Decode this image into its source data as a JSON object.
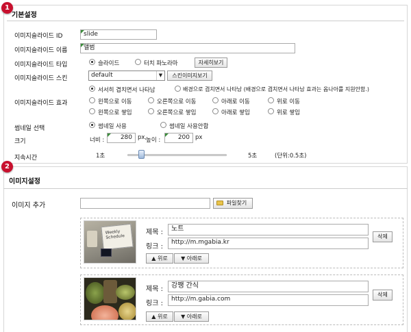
{
  "basic": {
    "badge": "1",
    "title": "기본설정",
    "fields": {
      "id_label": "이미지슬라이드 ID",
      "id_value": "slide",
      "name_label": "이미지슬라이드 이름",
      "name_value": "앨범",
      "type_label": "이미지슬라이드 타입",
      "type_options": [
        "슬라이드",
        "터치 파노라마"
      ],
      "type_detail_button": "자세히보기",
      "skin_label": "이미지슬라이드 스킨",
      "skin_value": "default",
      "skin_preview_button": "스킨이미지보기",
      "effect_label": "이미지슬라이드 효과",
      "effect_options": [
        "서서히 겹치면서 나타남",
        "배경으로 겹치면서 나타남 (배경으로 겹치면서 나타남 효과는 옵나아를 지원안함.)",
        "왼쪽으로 이동",
        "오른쪽으로 이동",
        "아래로 이동",
        "위로 이동",
        "왼쪽으로 쌓임",
        "오른쪽으로 쌓임",
        "아래로 쌓임",
        "위로 쌓임"
      ],
      "thumb_label": "썸네일 선택",
      "thumb_options": [
        "썸네일 사용",
        "썸네일 사용안함"
      ],
      "size_label": "크기",
      "width_label": "너비 :",
      "width_value": "280",
      "width_unit": "px,",
      "height_label": "높이 :",
      "height_value": "200",
      "height_unit": "px",
      "duration_label": "지속시간",
      "duration_min": "1초",
      "duration_max": "5초",
      "duration_unit": "(단위:0.5초)",
      "duration_level": 0.1
    }
  },
  "images": {
    "badge": "2",
    "title": "이미지설정",
    "add_label": "이미지 추가",
    "file_button": "파일찾기",
    "items": [
      {
        "title_label": "제목 :",
        "title_value": "노트",
        "link_label": "링크 :",
        "link_value": "http://m.mgabia.kr",
        "up": "▲ 위로",
        "down": "▼ 아래로",
        "delete": "삭제",
        "thumb_text": "Weekly Schedule"
      },
      {
        "title_label": "제목 :",
        "title_value": "강쨍 간식",
        "link_label": "링크 :",
        "link_value": "http://m.gabia.com",
        "up": "▲ 위로",
        "down": "▼ 아래로",
        "delete": "삭제",
        "thumb_text": ""
      }
    ]
  },
  "colors": {
    "badge": "#c8102e",
    "border": "#d6d6d6"
  }
}
